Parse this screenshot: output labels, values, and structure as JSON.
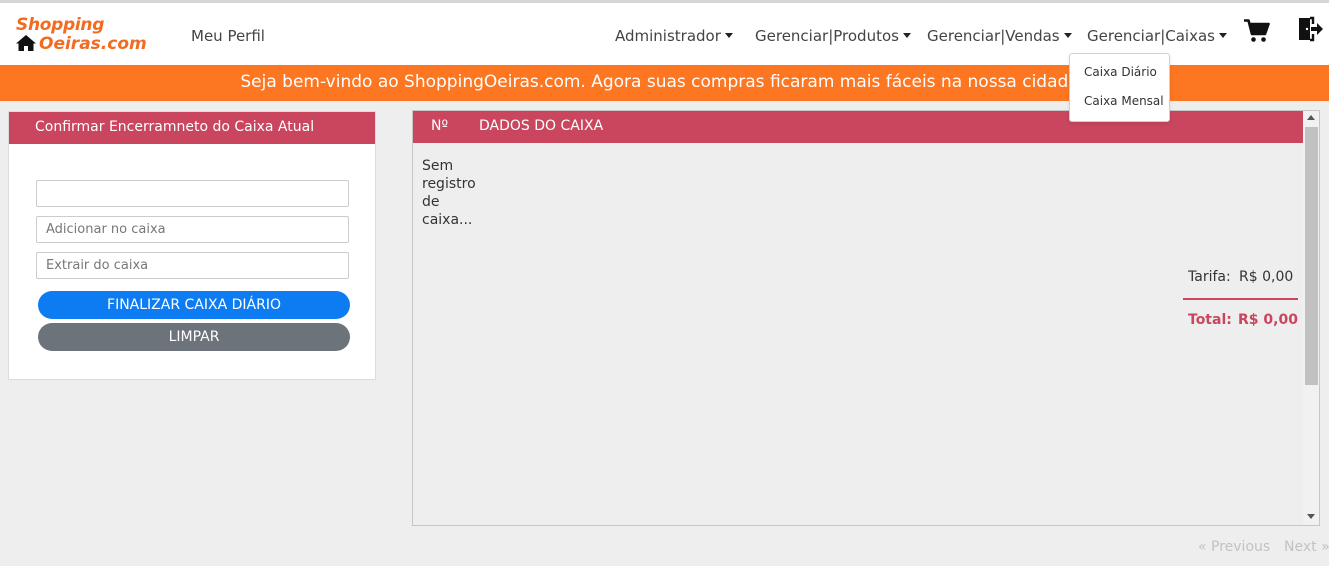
{
  "brand": {
    "line1": "Shopping",
    "line2": "Oeiras.com",
    "home_icon": "home-icon",
    "color": "#f26b21"
  },
  "nav": {
    "profile": "Meu Perfil",
    "admin": "Administrador",
    "products": "Gerenciar|Produtos",
    "sales": "Gerenciar|Vendas",
    "cashier": "Gerenciar|Caixas",
    "cart_icon": "shopping-cart-icon",
    "logout_icon": "logout-icon"
  },
  "dropdown": {
    "items": [
      "Caixa Diário",
      "Caixa Mensal"
    ]
  },
  "banner": {
    "text": "Seja bem-vindo ao ShoppingOeiras.com. Agora suas compras ficaram mais fáceis na nossa cidade!",
    "color": "#fd7622"
  },
  "form": {
    "title": "Confirmar Encerramneto do Caixa Atual",
    "value_field": "",
    "add_placeholder": "Adicionar no caixa",
    "extract_placeholder": "Extrair do caixa",
    "finalize_button": "FINALIZAR CAIXA DIÁRIO",
    "clear_button": "LIMPAR"
  },
  "table": {
    "columns": [
      "Nº",
      "DADOS DO CAIXA"
    ],
    "empty_message": "Sem registro de caixa...",
    "tarifa_label": "Tarifa:",
    "tarifa_value": "R$ 0,00",
    "total_label": "Total:",
    "total_value": "R$ 0,00",
    "accent_color": "#c9465e"
  },
  "pagination": {
    "previous": "« Previous",
    "next": "Next »"
  }
}
